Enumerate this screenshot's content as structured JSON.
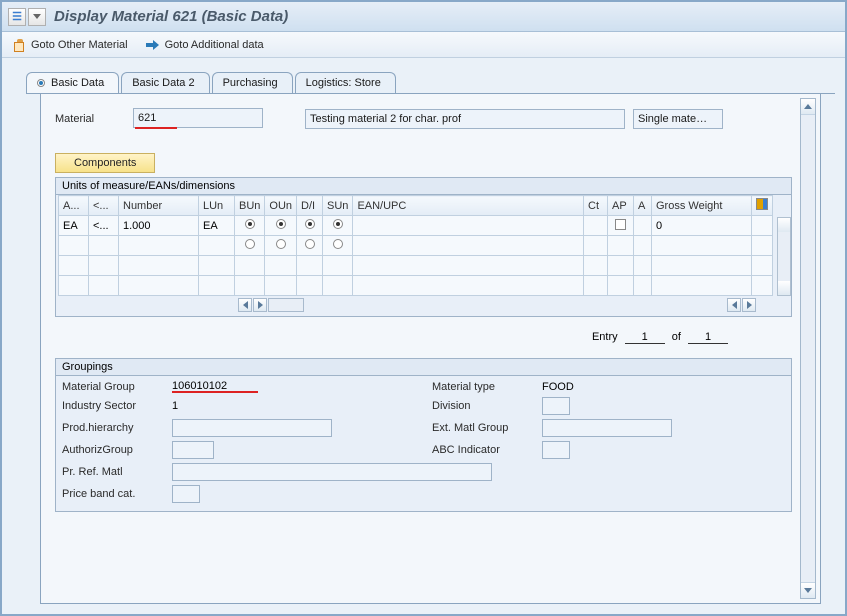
{
  "title": "Display Material 621 (Basic Data)",
  "toolbar": {
    "goto_other_material": "Goto Other Material",
    "goto_additional_data": "Goto Additional data"
  },
  "tabs": [
    {
      "label": "Basic Data",
      "active": true
    },
    {
      "label": "Basic Data 2",
      "active": false
    },
    {
      "label": "Purchasing",
      "active": false
    },
    {
      "label": "Logistics: Store",
      "active": false
    }
  ],
  "material": {
    "label": "Material",
    "number": "621",
    "description": "Testing material 2 for char. prof",
    "mode": "Single mate…"
  },
  "components_button": "Components",
  "uom_section": {
    "title": "Units of measure/EANs/dimensions",
    "columns": [
      "A...",
      "<...",
      "Number",
      "LUn",
      "BUn",
      "OUn",
      "D/I",
      "SUn",
      "EAN/UPC",
      "Ct",
      "AP",
      "A",
      "Gross Weight"
    ],
    "rows": [
      {
        "a": "EA",
        "lt": "<...",
        "number": "1.000",
        "lun": "EA",
        "bun": true,
        "oun": true,
        "di": true,
        "sun": true,
        "ean": "",
        "ct": "",
        "ap": false,
        "aflag": "",
        "gross": "0"
      }
    ],
    "entry": {
      "label": "Entry",
      "current": "1",
      "of_label": "of",
      "total": "1"
    }
  },
  "groupings": {
    "title": "Groupings",
    "material_group_label": "Material Group",
    "material_group": "106010102",
    "industry_sector_label": "Industry Sector",
    "industry_sector": "1",
    "prod_hierarchy_label": "Prod.hierarchy",
    "prod_hierarchy": "",
    "authoriz_group_label": "AuthorizGroup",
    "authoriz_group": "",
    "pr_ref_matl_label": "Pr. Ref. Matl",
    "pr_ref_matl": "",
    "price_band_cat_label": "Price band cat.",
    "price_band_cat": "",
    "material_type_label": "Material type",
    "material_type": "FOOD",
    "division_label": "Division",
    "division": "",
    "ext_matl_group_label": "Ext. Matl Group",
    "ext_matl_group": "",
    "abc_indicator_label": "ABC Indicator",
    "abc_indicator": ""
  }
}
